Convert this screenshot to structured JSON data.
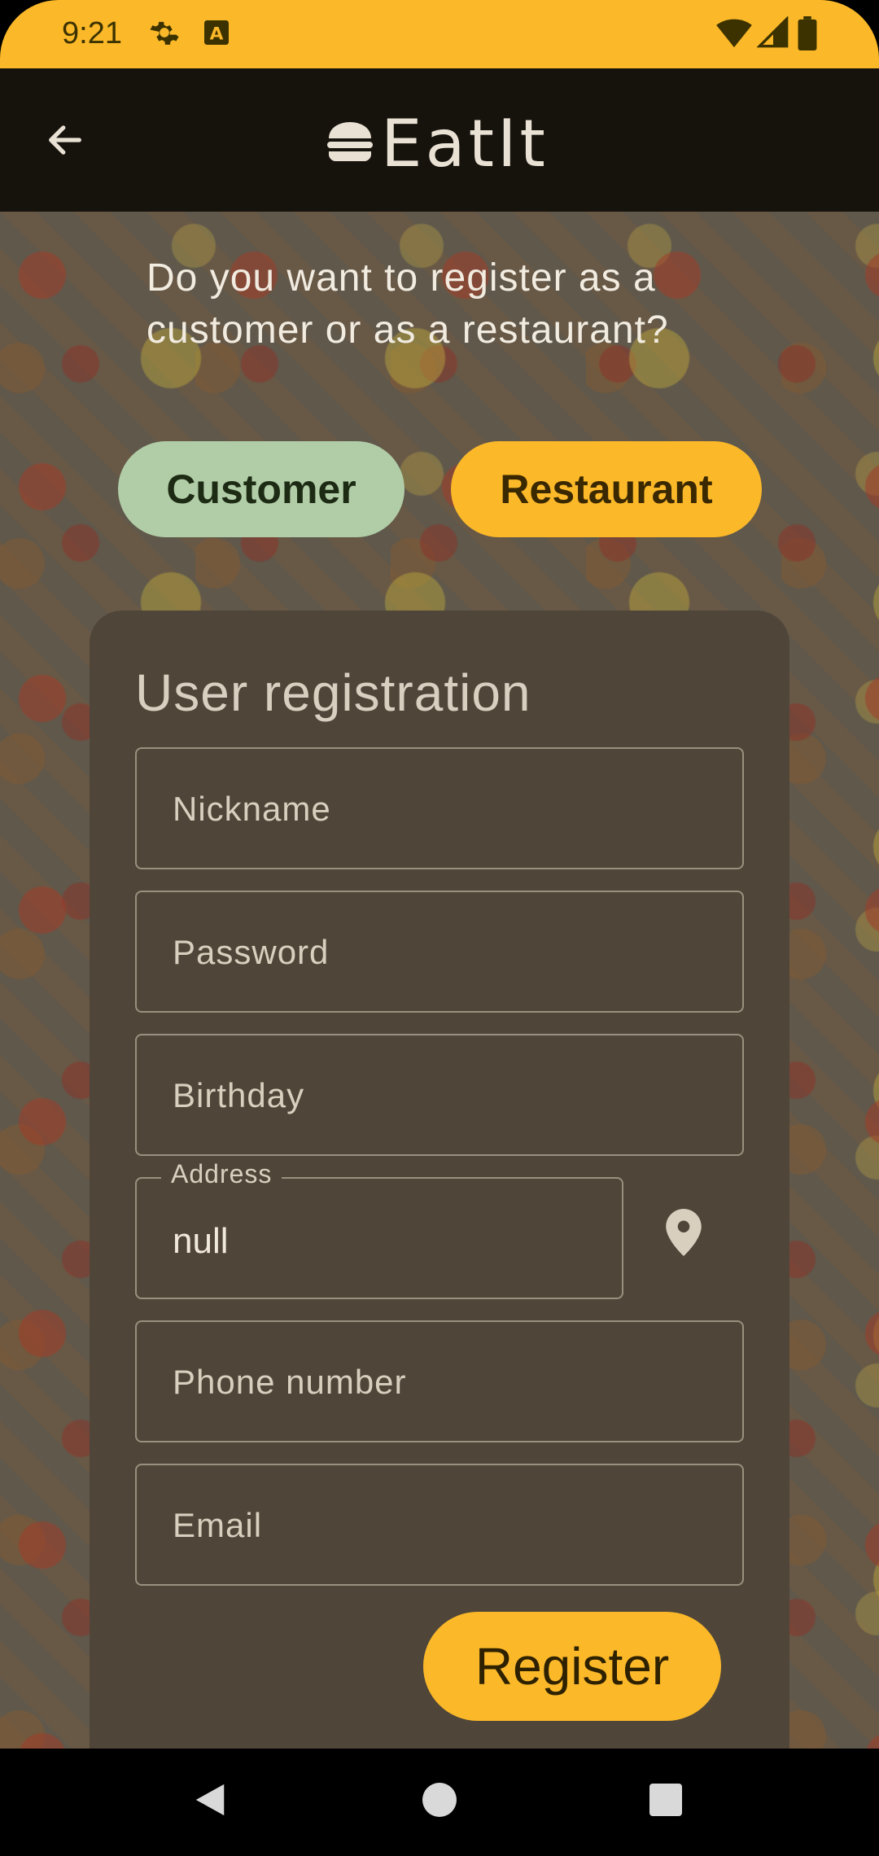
{
  "status_bar": {
    "time": "9:21",
    "icons": [
      "gear-icon",
      "a-icon",
      "wifi-icon",
      "signal-icon",
      "battery-icon"
    ]
  },
  "app_bar": {
    "title": "EatIt",
    "back_icon": "arrow-left-icon",
    "logo_icon": "burger-icon"
  },
  "question": "Do you want to register as a customer or as a restaurant?",
  "choices": {
    "customer_label": "Customer",
    "restaurant_label": "Restaurant"
  },
  "form": {
    "title": "User registration",
    "nickname_placeholder": "Nickname",
    "password_placeholder": "Password",
    "birthday_placeholder": "Birthday",
    "address_label": "Address",
    "address_value": "null",
    "phone_placeholder": "Phone number",
    "email_placeholder": "Email",
    "register_label": "Register",
    "location_icon": "location-pin-icon"
  },
  "colors": {
    "accent": "#FBB829",
    "customer_button": "#B1CDA7",
    "card": "#4F4639",
    "app_bar": "#16120C"
  }
}
